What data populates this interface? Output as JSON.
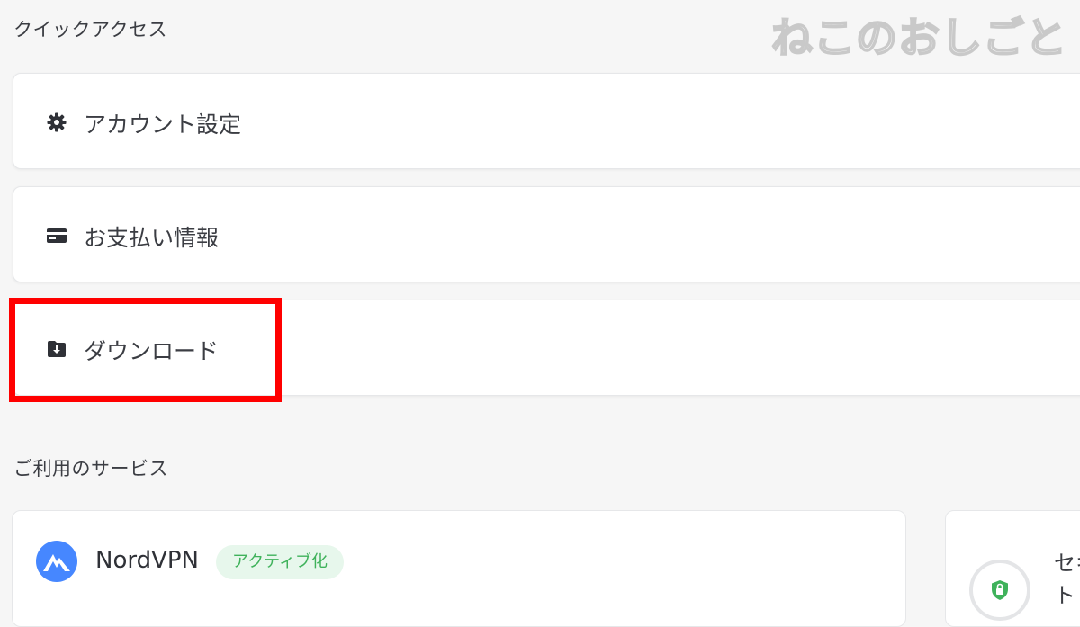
{
  "quick_access": {
    "title": "クイックアクセス",
    "items": [
      {
        "label": "アカウント設定",
        "icon": "gear-icon"
      },
      {
        "label": "お支払い情報",
        "icon": "credit-card-icon"
      },
      {
        "label": "ダウンロード",
        "icon": "download-folder-icon"
      }
    ]
  },
  "watermark": {
    "text": "ねこのおしごと"
  },
  "services": {
    "title": "ご利用のサービス",
    "cards": [
      {
        "name": "NordVPN",
        "badge": "アクティブ化",
        "icon": "nordvpn-logo-icon"
      },
      {
        "name": "セキュリティ\nト",
        "icon": "shield-lock-icon"
      }
    ]
  },
  "colors": {
    "highlight": "#ff0000",
    "badge_bg": "#e7f7ec",
    "badge_text": "#3fb25b",
    "nord_blue": "#4687ff"
  }
}
